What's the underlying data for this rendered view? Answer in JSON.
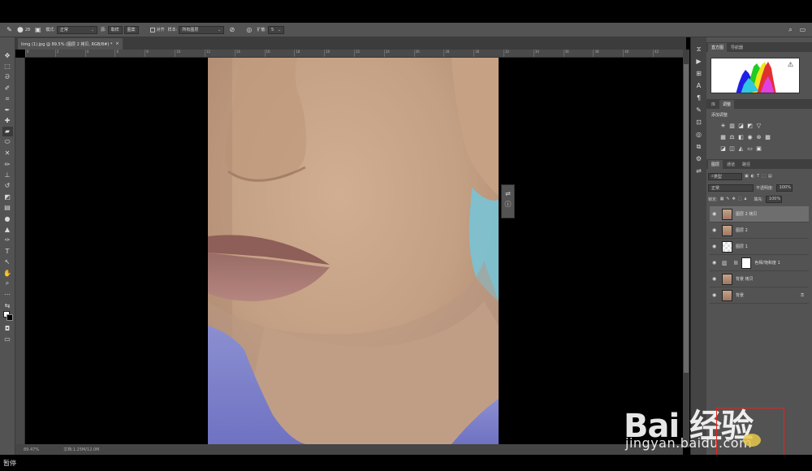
{
  "options_bar": {
    "mode_label": "模式:",
    "mode_value": "正常",
    "source_label": "源:",
    "source_btn1": "取样",
    "source_btn2": "图案",
    "align_label": "对齐",
    "sample_label": "样本:",
    "sample_value": "所有图层",
    "diffusion_label": "扩散:",
    "diffusion_value": "5",
    "brush_size": "28"
  },
  "document": {
    "tab_title": "timg (1).jpg @ 89.5% (图层 2 拷贝, RGB/8#) *"
  },
  "ruler_ticks": [
    "0",
    "2",
    "4",
    "6",
    "8",
    "10",
    "12",
    "14",
    "16",
    "18",
    "20",
    "22",
    "24",
    "26",
    "28",
    "30",
    "32",
    "34",
    "36",
    "38",
    "40",
    "42"
  ],
  "panels": {
    "histogram_tabs": [
      "直方图",
      "导航器"
    ],
    "adjust_tabs": [
      "库",
      "调整"
    ],
    "adjust_title": "添加调整",
    "layers_tabs": [
      "图层",
      "通道",
      "路径"
    ],
    "kind_filter": "类型",
    "blend_mode": "正常",
    "opacity_label": "不透明度:",
    "opacity_value": "100%",
    "lock_label": "锁定:",
    "fill_label": "填充:",
    "fill_value": "100%",
    "layers": [
      {
        "name": "图层 2 拷贝"
      },
      {
        "name": "图层 2"
      },
      {
        "name": "图层 1"
      },
      {
        "name": "色相/饱和度 1"
      },
      {
        "name": "背景 拷贝"
      },
      {
        "name": "背景"
      }
    ]
  },
  "status": {
    "zoom": "89.47%",
    "doc_info": "文档:1.25M/12.0M",
    "bottom_text": "暂停"
  },
  "watermark": {
    "brand": "Bai 经验",
    "url": "jingyan.baidu.com"
  },
  "colors": {
    "highlight_box": "#e0261e"
  }
}
